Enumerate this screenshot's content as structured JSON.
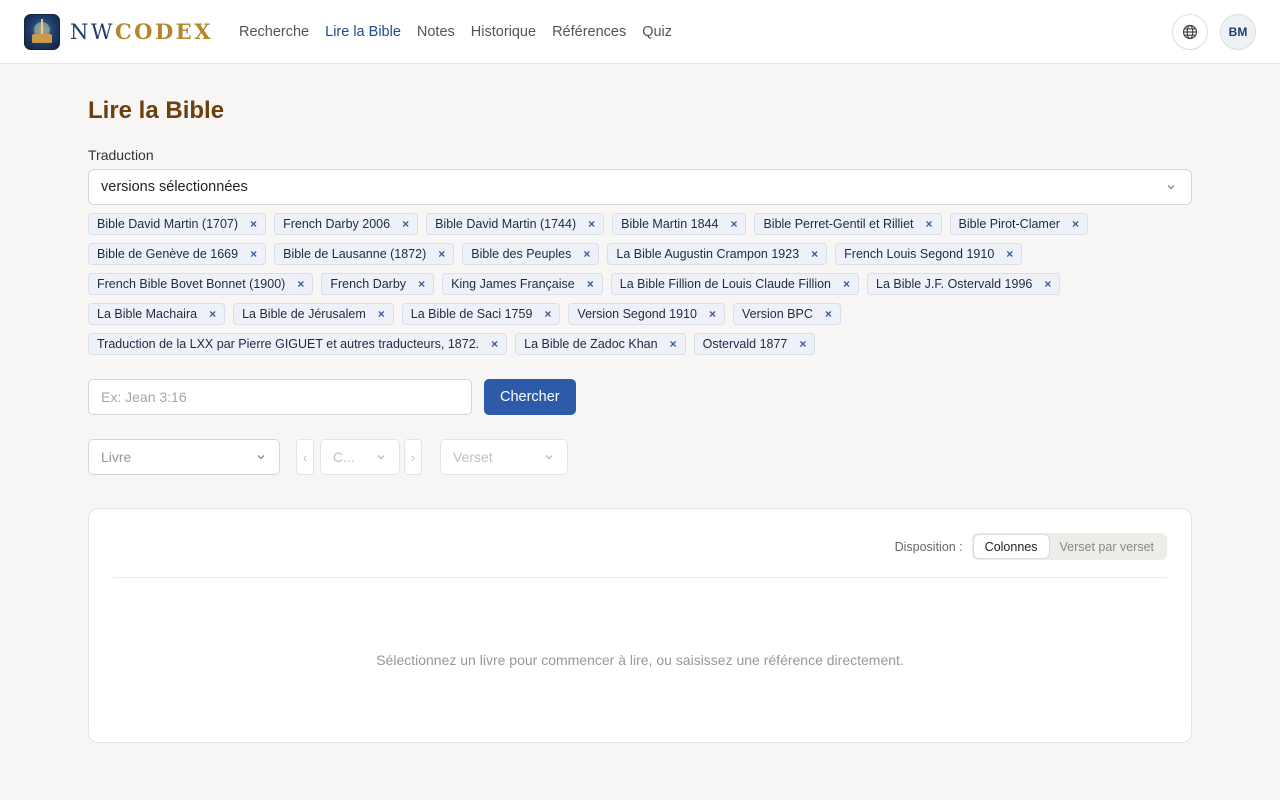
{
  "header": {
    "brand_nw": "NW",
    "brand_codex": "CODEX",
    "nav": [
      {
        "label": "Recherche",
        "active": false
      },
      {
        "label": "Lire la Bible",
        "active": true
      },
      {
        "label": "Notes",
        "active": false
      },
      {
        "label": "Historique",
        "active": false
      },
      {
        "label": "Références",
        "active": false
      },
      {
        "label": "Quiz",
        "active": false
      }
    ],
    "avatar_initials": "BM"
  },
  "page": {
    "title": "Lire la Bible",
    "translation_label": "Traduction",
    "translation_value": "versions sélectionnées"
  },
  "chips": [
    "Bible David Martin (1707)",
    "French Darby 2006",
    "Bible David Martin (1744)",
    "Bible Martin 1844",
    "Bible Perret-Gentil et Rilliet",
    "Bible Pirot-Clamer",
    "Bible de Genève de 1669",
    "Bible de Lausanne (1872)",
    "Bible des Peuples",
    "La Bible Augustin Crampon 1923",
    "French Louis Segond 1910",
    "French Bible Bovet Bonnet (1900)",
    "French Darby",
    "King James Française",
    "La Bible Fillion de Louis Claude Fillion",
    "La Bible J.F. Ostervald 1996",
    "La Bible Machaira",
    "La Bible de Jérusalem",
    "La Bible de Saci 1759",
    "Version Segond 1910",
    "Version BPC",
    "Traduction de la LXX par Pierre GIGUET et autres traducteurs, 1872.",
    "La Bible de Zadoc Khan",
    "Ostervald 1877"
  ],
  "chip_remove": "×",
  "search": {
    "placeholder": "Ex: Jean 3:16",
    "button": "Chercher"
  },
  "pickers": {
    "book": "Livre",
    "chapter": "C...",
    "verse": "Verset",
    "prev": "‹",
    "next": "›"
  },
  "reader": {
    "layout_label": "Disposition :",
    "options": [
      {
        "label": "Colonnes",
        "active": true
      },
      {
        "label": "Verset par verset",
        "active": false
      }
    ],
    "empty_message": "Sélectionnez un livre pour commencer à lire, ou saisissez une référence directement."
  },
  "colors": {
    "accent": "#2d5ba9",
    "title": "#6b3f0e",
    "brand_nw": "#1f3c6e",
    "brand_codex": "#b6862d"
  },
  "icons": {
    "globe": "globe-icon",
    "chevron": "chevron-down-icon",
    "remove": "close-icon"
  }
}
